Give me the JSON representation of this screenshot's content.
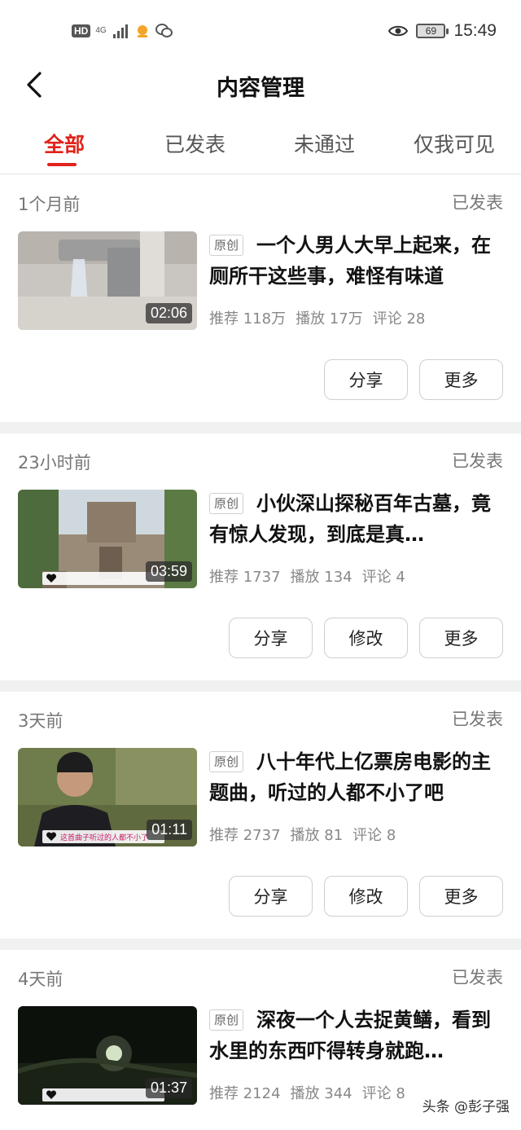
{
  "status_bar": {
    "hd": "HD",
    "net": "4G",
    "battery": "69",
    "time": "15:49"
  },
  "header": {
    "title": "内容管理"
  },
  "tabs": [
    {
      "label": "全部",
      "active": true
    },
    {
      "label": "已发表"
    },
    {
      "label": "未通过"
    },
    {
      "label": "仅我可见"
    }
  ],
  "colors": {
    "accent": "#e0231b"
  },
  "items": [
    {
      "time": "1个月前",
      "status": "已发表",
      "badge": "原创",
      "title": "一个人男人大早上起来，在厕所干这些事，难怪有味道",
      "duration": "02:06",
      "caption": "",
      "stats": {
        "rec": "推荐 118万",
        "play": "播放 17万",
        "comment": "评论 28"
      },
      "buttons": [
        "分享",
        "更多"
      ]
    },
    {
      "time": "23小时前",
      "status": "已发表",
      "badge": "原创",
      "title": "小伙深山探秘百年古墓，竟有惊人发现，到底是真…",
      "duration": "03:59",
      "caption": "",
      "stats": {
        "rec": "推荐 1737",
        "play": "播放 134",
        "comment": "评论 4"
      },
      "buttons": [
        "分享",
        "修改",
        "更多"
      ]
    },
    {
      "time": "3天前",
      "status": "已发表",
      "badge": "原创",
      "title": "八十年代上亿票房电影的主题曲，听过的人都不小了吧",
      "duration": "01:11",
      "caption": "这首曲子听过的人都不小了",
      "stats": {
        "rec": "推荐 2737",
        "play": "播放 81",
        "comment": "评论 8"
      },
      "buttons": [
        "分享",
        "修改",
        "更多"
      ]
    },
    {
      "time": "4天前",
      "status": "已发表",
      "badge": "原创",
      "title": "深夜一个人去捉黄鳝，看到水里的东西吓得转身就跑…",
      "duration": "01:37",
      "caption": "",
      "stats": {
        "rec": "推荐 2124",
        "play": "播放 344",
        "comment": "评论 8"
      },
      "buttons": []
    }
  ],
  "watermark": "头条 @彭子强"
}
